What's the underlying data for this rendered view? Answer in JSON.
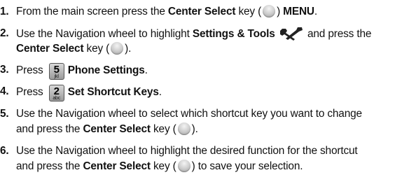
{
  "steps": [
    {
      "num": "1.",
      "line1": {
        "t1": "From the main screen press the ",
        "b1": "Center Select",
        "t2": " key (",
        "t3": ") ",
        "b2": "MENU",
        "t4": "."
      }
    },
    {
      "num": "2.",
      "line1": {
        "t1": "Use the Navigation wheel to highlight ",
        "b1": "Settings & Tools",
        "t2": " and press the"
      },
      "line2": {
        "b1": "Center Select",
        "t1": " key (",
        "t2": ")."
      },
      "icon": "settings-tools-icon"
    },
    {
      "num": "3.",
      "line1": {
        "t1": "Press",
        "key_digit": "5",
        "key_letters": "jkl",
        "b1": "Phone Settings",
        "t2": "."
      }
    },
    {
      "num": "4.",
      "line1": {
        "t1": "Press",
        "key_digit": "2",
        "key_letters": "abc",
        "b1": "Set Shortcut Keys",
        "t2": "."
      }
    },
    {
      "num": "5.",
      "line1": {
        "t1": "Use the Navigation wheel to select which shortcut key you want to change"
      },
      "line2": {
        "t1": "and press the ",
        "b1": "Center Select",
        "t2": " key (",
        "t3": ")."
      }
    },
    {
      "num": "6.",
      "line1": {
        "t1": "Use the Navigation wheel to highlight the desired function for the shortcut"
      },
      "line2": {
        "t1": "and press the ",
        "b1": "Center Select",
        "t2": " key (",
        "t3": ") to save your selection."
      }
    }
  ],
  "colors": {
    "text": "#111111",
    "select_button": "#c9c9c9",
    "key_face": "#b8b8b8"
  }
}
